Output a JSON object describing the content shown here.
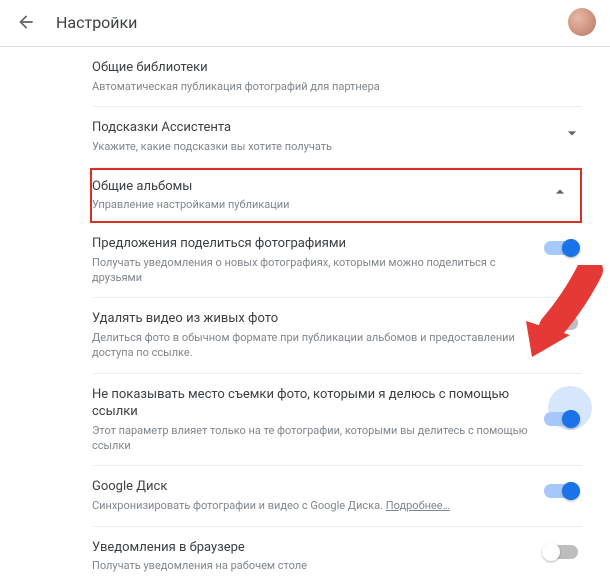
{
  "header": {
    "title": "Настройки"
  },
  "sections": {
    "shared_libs": {
      "title": "Общие библиотеки",
      "sub": "Автоматическая публикация фотографий для партнера"
    },
    "assistant_tips": {
      "title": "Подсказки Ассистента",
      "sub": "Укажите, какие подсказки вы хотите получать"
    },
    "shared_albums": {
      "title": "Общие альбомы",
      "sub": "Управление настройками публикации"
    },
    "share_suggestions": {
      "title": "Предложения поделиться фотографиями",
      "sub": "Получать уведомления о новых фотографиях, которыми можно поделиться с друзьями"
    },
    "remove_video": {
      "title": "Удалять видео из живых фото",
      "sub": "Делиться фото в обычном формате при публикации альбомов и предоставлении доступа по ссылке."
    },
    "hide_location": {
      "title": "Не показывать место съемки фото, которыми я делюсь с помощью ссылки",
      "sub": "Этот параметр влияет только на те фотографии, которыми вы делитесь с помощью ссылки"
    },
    "google_drive": {
      "title": "Google Диск",
      "sub_pre": "Синхронизировать фотографии и видео с Google Диска. ",
      "link": "Подробнее…"
    },
    "browser_notifs": {
      "title": "Уведомления в браузере",
      "sub": "Получать уведомления на рабочем столе"
    }
  }
}
